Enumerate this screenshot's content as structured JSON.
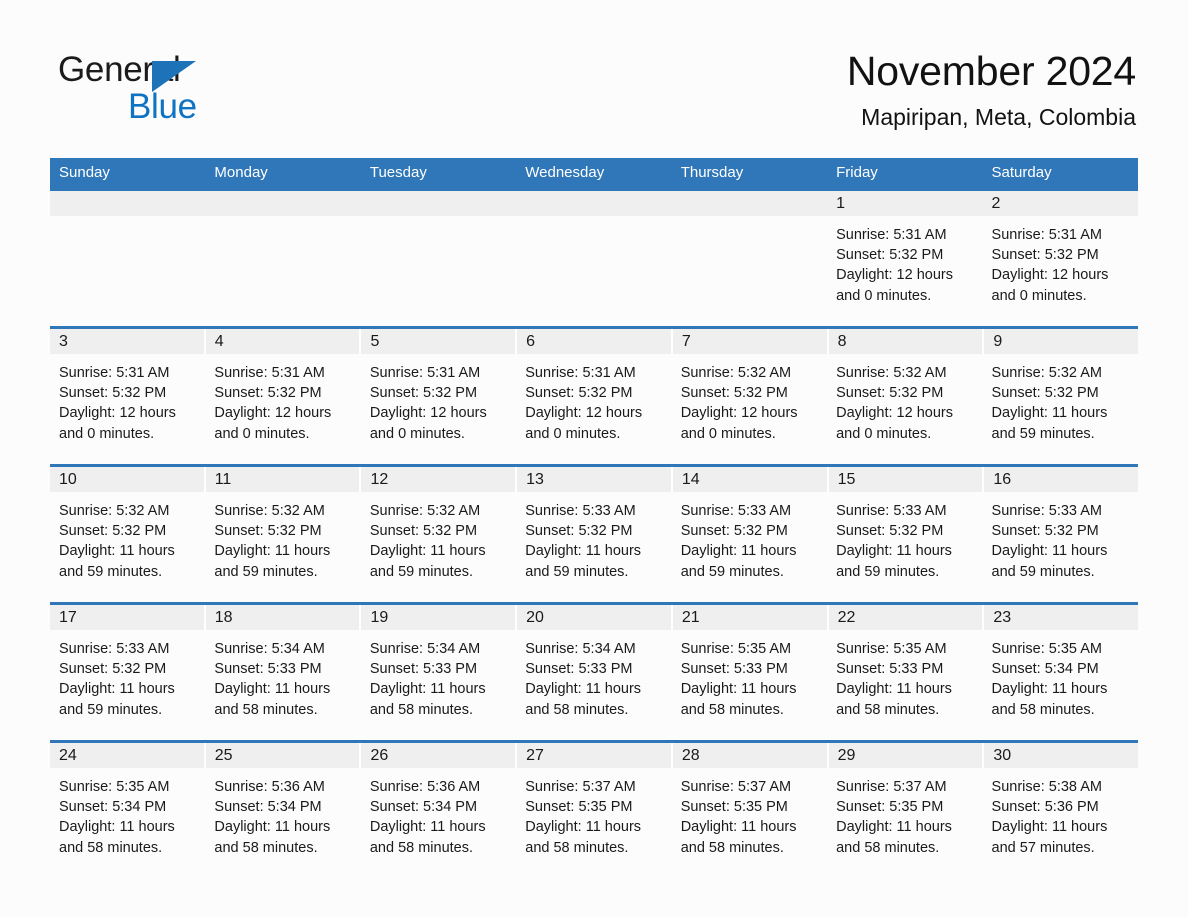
{
  "brand": {
    "name_part1": "General",
    "name_part2": "Blue",
    "triangle_color": "#1d72b8",
    "blue_color": "#0f73c4"
  },
  "header": {
    "title": "November 2024",
    "subtitle": "Mapiripan, Meta, Colombia"
  },
  "theme": {
    "header_bar_color": "#2f77b8",
    "date_strip_color": "#efefef",
    "page_background": "#fcfcfc",
    "text_color": "#1a1a1a"
  },
  "weekdays": [
    "Sunday",
    "Monday",
    "Tuesday",
    "Wednesday",
    "Thursday",
    "Friday",
    "Saturday"
  ],
  "weeks": [
    {
      "contiguous_strip": true,
      "days": [
        {
          "date": "",
          "lines": []
        },
        {
          "date": "",
          "lines": []
        },
        {
          "date": "",
          "lines": []
        },
        {
          "date": "",
          "lines": []
        },
        {
          "date": "",
          "lines": []
        },
        {
          "date": "1",
          "lines": [
            "Sunrise: 5:31 AM",
            "Sunset: 5:32 PM",
            "Daylight: 12 hours",
            "and 0 minutes."
          ]
        },
        {
          "date": "2",
          "lines": [
            "Sunrise: 5:31 AM",
            "Sunset: 5:32 PM",
            "Daylight: 12 hours",
            "and 0 minutes."
          ]
        }
      ]
    },
    {
      "contiguous_strip": false,
      "days": [
        {
          "date": "3",
          "lines": [
            "Sunrise: 5:31 AM",
            "Sunset: 5:32 PM",
            "Daylight: 12 hours",
            "and 0 minutes."
          ]
        },
        {
          "date": "4",
          "lines": [
            "Sunrise: 5:31 AM",
            "Sunset: 5:32 PM",
            "Daylight: 12 hours",
            "and 0 minutes."
          ]
        },
        {
          "date": "5",
          "lines": [
            "Sunrise: 5:31 AM",
            "Sunset: 5:32 PM",
            "Daylight: 12 hours",
            "and 0 minutes."
          ]
        },
        {
          "date": "6",
          "lines": [
            "Sunrise: 5:31 AM",
            "Sunset: 5:32 PM",
            "Daylight: 12 hours",
            "and 0 minutes."
          ]
        },
        {
          "date": "7",
          "lines": [
            "Sunrise: 5:32 AM",
            "Sunset: 5:32 PM",
            "Daylight: 12 hours",
            "and 0 minutes."
          ]
        },
        {
          "date": "8",
          "lines": [
            "Sunrise: 5:32 AM",
            "Sunset: 5:32 PM",
            "Daylight: 12 hours",
            "and 0 minutes."
          ]
        },
        {
          "date": "9",
          "lines": [
            "Sunrise: 5:32 AM",
            "Sunset: 5:32 PM",
            "Daylight: 11 hours",
            "and 59 minutes."
          ]
        }
      ]
    },
    {
      "contiguous_strip": false,
      "days": [
        {
          "date": "10",
          "lines": [
            "Sunrise: 5:32 AM",
            "Sunset: 5:32 PM",
            "Daylight: 11 hours",
            "and 59 minutes."
          ]
        },
        {
          "date": "11",
          "lines": [
            "Sunrise: 5:32 AM",
            "Sunset: 5:32 PM",
            "Daylight: 11 hours",
            "and 59 minutes."
          ]
        },
        {
          "date": "12",
          "lines": [
            "Sunrise: 5:32 AM",
            "Sunset: 5:32 PM",
            "Daylight: 11 hours",
            "and 59 minutes."
          ]
        },
        {
          "date": "13",
          "lines": [
            "Sunrise: 5:33 AM",
            "Sunset: 5:32 PM",
            "Daylight: 11 hours",
            "and 59 minutes."
          ]
        },
        {
          "date": "14",
          "lines": [
            "Sunrise: 5:33 AM",
            "Sunset: 5:32 PM",
            "Daylight: 11 hours",
            "and 59 minutes."
          ]
        },
        {
          "date": "15",
          "lines": [
            "Sunrise: 5:33 AM",
            "Sunset: 5:32 PM",
            "Daylight: 11 hours",
            "and 59 minutes."
          ]
        },
        {
          "date": "16",
          "lines": [
            "Sunrise: 5:33 AM",
            "Sunset: 5:32 PM",
            "Daylight: 11 hours",
            "and 59 minutes."
          ]
        }
      ]
    },
    {
      "contiguous_strip": false,
      "days": [
        {
          "date": "17",
          "lines": [
            "Sunrise: 5:33 AM",
            "Sunset: 5:32 PM",
            "Daylight: 11 hours",
            "and 59 minutes."
          ]
        },
        {
          "date": "18",
          "lines": [
            "Sunrise: 5:34 AM",
            "Sunset: 5:33 PM",
            "Daylight: 11 hours",
            "and 58 minutes."
          ]
        },
        {
          "date": "19",
          "lines": [
            "Sunrise: 5:34 AM",
            "Sunset: 5:33 PM",
            "Daylight: 11 hours",
            "and 58 minutes."
          ]
        },
        {
          "date": "20",
          "lines": [
            "Sunrise: 5:34 AM",
            "Sunset: 5:33 PM",
            "Daylight: 11 hours",
            "and 58 minutes."
          ]
        },
        {
          "date": "21",
          "lines": [
            "Sunrise: 5:35 AM",
            "Sunset: 5:33 PM",
            "Daylight: 11 hours",
            "and 58 minutes."
          ]
        },
        {
          "date": "22",
          "lines": [
            "Sunrise: 5:35 AM",
            "Sunset: 5:33 PM",
            "Daylight: 11 hours",
            "and 58 minutes."
          ]
        },
        {
          "date": "23",
          "lines": [
            "Sunrise: 5:35 AM",
            "Sunset: 5:34 PM",
            "Daylight: 11 hours",
            "and 58 minutes."
          ]
        }
      ]
    },
    {
      "contiguous_strip": false,
      "days": [
        {
          "date": "24",
          "lines": [
            "Sunrise: 5:35 AM",
            "Sunset: 5:34 PM",
            "Daylight: 11 hours",
            "and 58 minutes."
          ]
        },
        {
          "date": "25",
          "lines": [
            "Sunrise: 5:36 AM",
            "Sunset: 5:34 PM",
            "Daylight: 11 hours",
            "and 58 minutes."
          ]
        },
        {
          "date": "26",
          "lines": [
            "Sunrise: 5:36 AM",
            "Sunset: 5:34 PM",
            "Daylight: 11 hours",
            "and 58 minutes."
          ]
        },
        {
          "date": "27",
          "lines": [
            "Sunrise: 5:37 AM",
            "Sunset: 5:35 PM",
            "Daylight: 11 hours",
            "and 58 minutes."
          ]
        },
        {
          "date": "28",
          "lines": [
            "Sunrise: 5:37 AM",
            "Sunset: 5:35 PM",
            "Daylight: 11 hours",
            "and 58 minutes."
          ]
        },
        {
          "date": "29",
          "lines": [
            "Sunrise: 5:37 AM",
            "Sunset: 5:35 PM",
            "Daylight: 11 hours",
            "and 58 minutes."
          ]
        },
        {
          "date": "30",
          "lines": [
            "Sunrise: 5:38 AM",
            "Sunset: 5:36 PM",
            "Daylight: 11 hours",
            "and 57 minutes."
          ]
        }
      ]
    }
  ]
}
